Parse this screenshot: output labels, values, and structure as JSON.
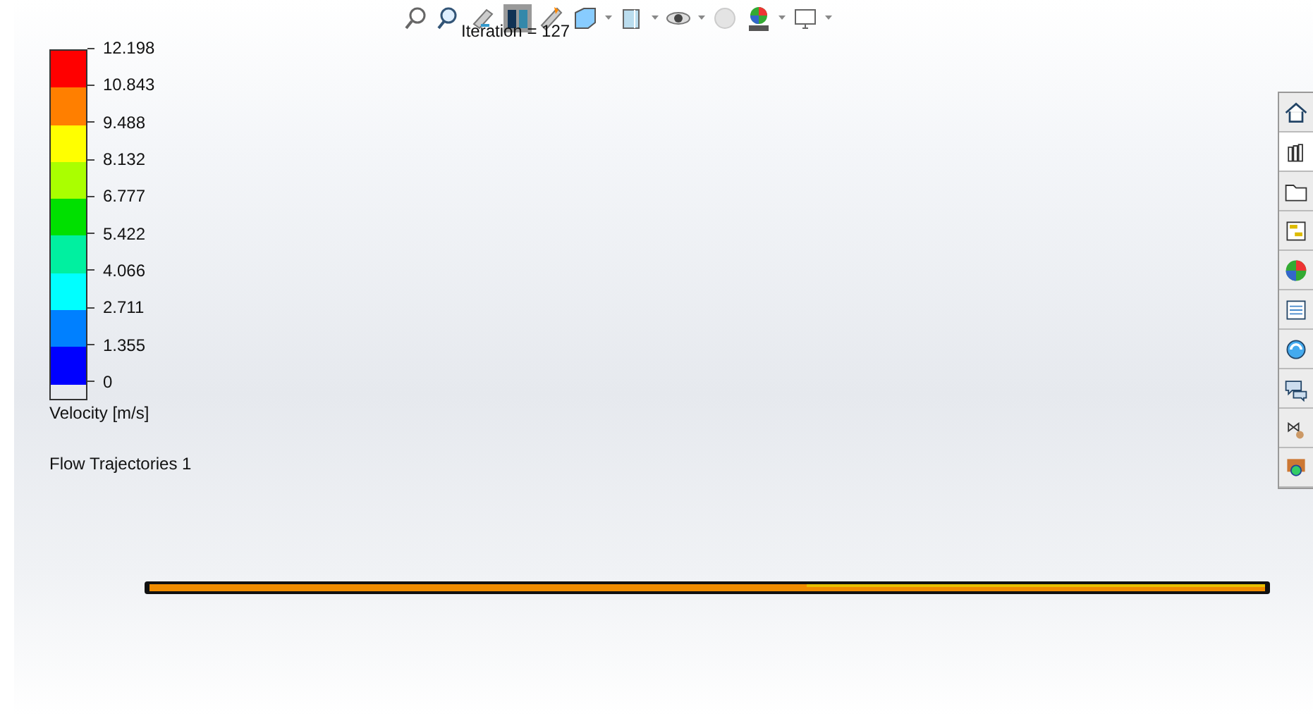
{
  "toolbar": {
    "iteration": "Iteration = 127"
  },
  "legend": {
    "labels": [
      "12.198",
      "10.843",
      "9.488",
      "8.132",
      "6.777",
      "5.422",
      "4.066",
      "2.711",
      "1.355",
      "0"
    ],
    "bands": [
      {
        "color": "#ff0000"
      },
      {
        "color": "#ff7f00"
      },
      {
        "color": "#ffff00"
      },
      {
        "color": "#aaff00"
      },
      {
        "color": "#00e000"
      },
      {
        "color": "#00f0a0"
      },
      {
        "color": "#00ffff"
      },
      {
        "color": "#0080ff"
      },
      {
        "color": "#0000ff"
      }
    ],
    "title": "Velocity [m/s]",
    "plot_name": "Flow Trajectories 1"
  }
}
